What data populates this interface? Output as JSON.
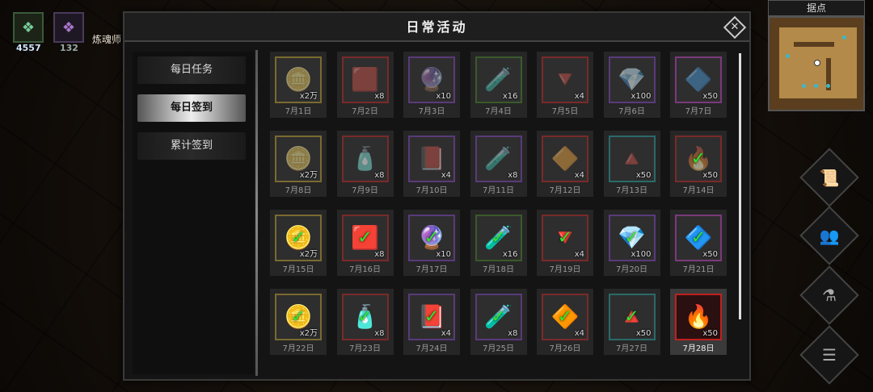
{
  "hud": {
    "slot1_value": "4557",
    "slot2_value": "132",
    "npc_name": "炼魂师"
  },
  "minimap": {
    "title": "据点"
  },
  "dialog": {
    "title": "日常活动",
    "close_label": "✕"
  },
  "tabs": [
    {
      "label": "每日任务",
      "active": false
    },
    {
      "label": "每日签到",
      "active": true
    },
    {
      "label": "累计签到",
      "active": false
    }
  ],
  "rewards": [
    {
      "day": "7月1日",
      "qty": "x2万",
      "icon": "gold-coins-icon",
      "glyph": "🪙",
      "frame": "gold",
      "claimed": false,
      "faded": true
    },
    {
      "day": "7月2日",
      "qty": "x8",
      "icon": "red-ore-icon",
      "glyph": "🟥",
      "frame": "red",
      "claimed": false,
      "faded": true
    },
    {
      "day": "7月3日",
      "qty": "x10",
      "icon": "purple-crystal-cluster-icon",
      "glyph": "🔮",
      "frame": "purple",
      "claimed": false,
      "faded": true
    },
    {
      "day": "7月4日",
      "qty": "x16",
      "icon": "green-potion-icon",
      "glyph": "🧪",
      "frame": "green",
      "claimed": false,
      "faded": true
    },
    {
      "day": "7月5日",
      "qty": "x4",
      "icon": "red-shard-icon",
      "glyph": "🔻",
      "frame": "red",
      "claimed": false,
      "faded": true
    },
    {
      "day": "7月6日",
      "qty": "x100",
      "icon": "purple-gem-icon",
      "glyph": "💎",
      "frame": "purple",
      "claimed": false,
      "faded": true
    },
    {
      "day": "7月7日",
      "qty": "x50",
      "icon": "violet-diamond-icon",
      "glyph": "🔷",
      "frame": "pink",
      "claimed": false,
      "faded": true
    },
    {
      "day": "7月8日",
      "qty": "x2万",
      "icon": "gold-coins-icon",
      "glyph": "🪙",
      "frame": "gold",
      "claimed": false,
      "faded": true
    },
    {
      "day": "7月9日",
      "qty": "x8",
      "icon": "red-vial-icon",
      "glyph": "🧴",
      "frame": "red",
      "claimed": false,
      "faded": true
    },
    {
      "day": "7月10日",
      "qty": "x4",
      "icon": "purple-book-icon",
      "glyph": "📕",
      "frame": "purple",
      "claimed": false,
      "faded": true
    },
    {
      "day": "7月11日",
      "qty": "x8",
      "icon": "purple-potion-icon",
      "glyph": "🧪",
      "frame": "purple",
      "claimed": false,
      "faded": true
    },
    {
      "day": "7月12日",
      "qty": "x4",
      "icon": "red-crystal-icon",
      "glyph": "🔶",
      "frame": "red",
      "claimed": false,
      "faded": true
    },
    {
      "day": "7月13日",
      "qty": "x50",
      "icon": "cyan-pyramid-icon",
      "glyph": "🔺",
      "frame": "cyan",
      "claimed": false,
      "faded": true
    },
    {
      "day": "7月14日",
      "qty": "x50",
      "icon": "fire-orb-icon",
      "glyph": "🔥",
      "frame": "red",
      "claimed": true,
      "faded": true
    },
    {
      "day": "7月15日",
      "qty": "x2万",
      "icon": "gold-coins-icon",
      "glyph": "🪙",
      "frame": "gold",
      "claimed": true,
      "faded": false
    },
    {
      "day": "7月16日",
      "qty": "x8",
      "icon": "red-ore-icon",
      "glyph": "🟥",
      "frame": "red",
      "claimed": true,
      "faded": false
    },
    {
      "day": "7月17日",
      "qty": "x10",
      "icon": "purple-crystal-cluster-icon",
      "glyph": "🔮",
      "frame": "purple",
      "claimed": true,
      "faded": false
    },
    {
      "day": "7月18日",
      "qty": "x16",
      "icon": "green-potion-icon",
      "glyph": "🧪",
      "frame": "green",
      "claimed": true,
      "faded": false
    },
    {
      "day": "7月19日",
      "qty": "x4",
      "icon": "red-shard-icon",
      "glyph": "🔻",
      "frame": "red",
      "claimed": true,
      "faded": false
    },
    {
      "day": "7月20日",
      "qty": "x100",
      "icon": "purple-gem-icon",
      "glyph": "💎",
      "frame": "purple",
      "claimed": true,
      "faded": false
    },
    {
      "day": "7月21日",
      "qty": "x50",
      "icon": "violet-diamond-icon",
      "glyph": "🔷",
      "frame": "pink",
      "claimed": true,
      "faded": false
    },
    {
      "day": "7月22日",
      "qty": "x2万",
      "icon": "gold-coins-icon",
      "glyph": "🪙",
      "frame": "gold",
      "claimed": true,
      "faded": false
    },
    {
      "day": "7月23日",
      "qty": "x8",
      "icon": "red-vial-icon",
      "glyph": "🧴",
      "frame": "red",
      "claimed": true,
      "faded": false
    },
    {
      "day": "7月24日",
      "qty": "x4",
      "icon": "purple-book-icon",
      "glyph": "📕",
      "frame": "purple",
      "claimed": true,
      "faded": false
    },
    {
      "day": "7月25日",
      "qty": "x8",
      "icon": "purple-potion-icon",
      "glyph": "🧪",
      "frame": "purple",
      "claimed": true,
      "faded": false
    },
    {
      "day": "7月26日",
      "qty": "x4",
      "icon": "red-crystal-icon",
      "glyph": "🔶",
      "frame": "red",
      "claimed": true,
      "faded": false
    },
    {
      "day": "7月27日",
      "qty": "x50",
      "icon": "cyan-pyramid-icon",
      "glyph": "🔺",
      "frame": "cyan",
      "claimed": true,
      "faded": false
    },
    {
      "day": "7月28日",
      "qty": "x50",
      "icon": "fire-orb-icon",
      "glyph": "🔥",
      "frame": "red",
      "claimed": false,
      "faded": false,
      "today": true
    }
  ],
  "side_buttons": [
    {
      "icon": "scroll-icon",
      "glyph": "📜"
    },
    {
      "icon": "group-icon",
      "glyph": "👥"
    },
    {
      "icon": "potion-icon",
      "glyph": "⚗"
    },
    {
      "icon": "menu-list-icon",
      "glyph": "☰"
    }
  ],
  "colors": {
    "check": "#2ee82e",
    "today_frame": "#c02020",
    "dialog_bg": "#141414"
  }
}
